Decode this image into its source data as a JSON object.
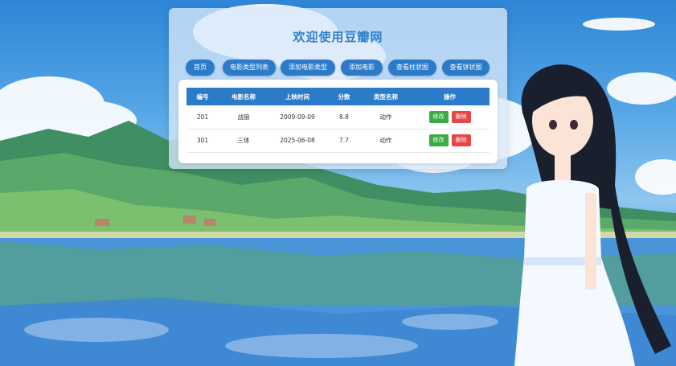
{
  "header": {
    "title": "欢迎使用豆瓣网"
  },
  "nav": [
    {
      "label": "首页"
    },
    {
      "label": "电影类型列表"
    },
    {
      "label": "添加电影类型"
    },
    {
      "label": "添加电影"
    },
    {
      "label": "查看柱状图"
    },
    {
      "label": "查看饼状图"
    }
  ],
  "table": {
    "headers": [
      "编号",
      "电影名称",
      "上映时间",
      "分数",
      "类型名称",
      "操作"
    ],
    "rows": [
      {
        "id": "201",
        "name": "战狼",
        "release": "2009-09-09",
        "score": "8.8",
        "type": "动作",
        "edit": "修改",
        "delete": "删除"
      },
      {
        "id": "301",
        "name": "三体",
        "release": "2025-06-08",
        "score": "7.7",
        "type": "动作",
        "edit": "修改",
        "delete": "删除"
      }
    ]
  },
  "colors": {
    "primary": "#2c7bc9",
    "edit": "#3daa47",
    "delete": "#e84545"
  }
}
